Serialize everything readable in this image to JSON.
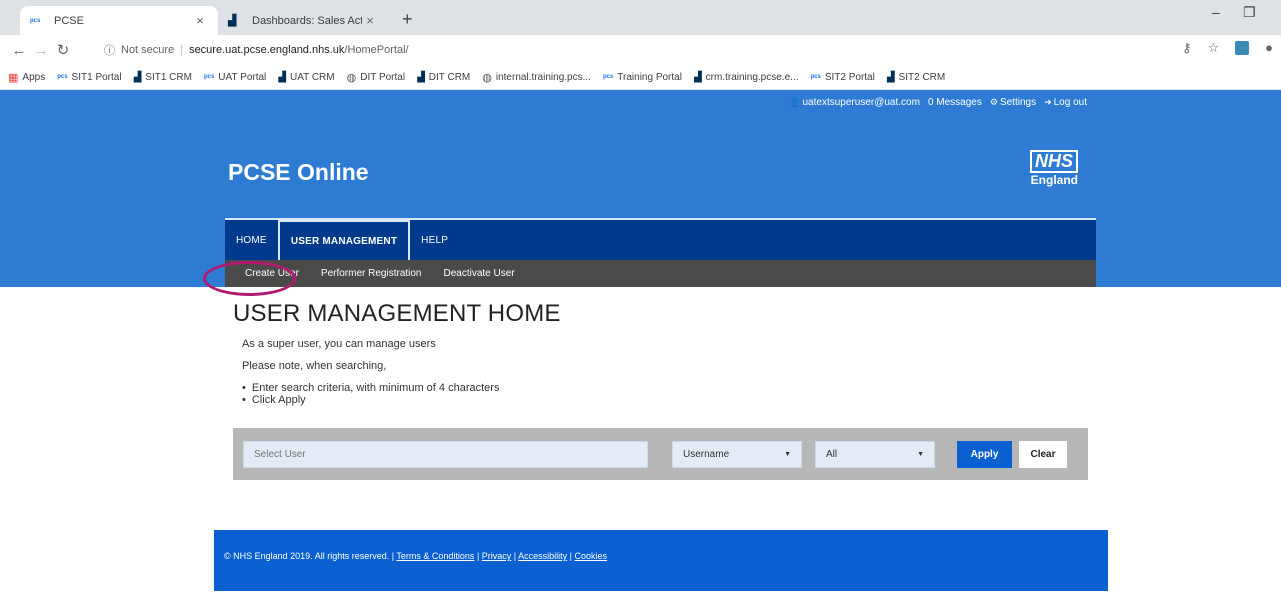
{
  "browser": {
    "tabs": [
      {
        "favicon": "pcs",
        "title": "PCSE",
        "close": "×"
      },
      {
        "favicon": "crm",
        "title": "Dashboards: Sales Activity Social",
        "close": "×"
      }
    ],
    "new_tab": "+",
    "window_controls": {
      "minimize": "–",
      "restore": "❐"
    },
    "address": {
      "security": "Not secure",
      "host": "secure.uat.pcse.england.nhs.uk",
      "path": "/HomePortal/"
    },
    "bookmarks": [
      {
        "icon": "apps",
        "label": "Apps"
      },
      {
        "icon": "pcs",
        "label": "SIT1 Portal"
      },
      {
        "icon": "crm",
        "label": "SIT1 CRM"
      },
      {
        "icon": "pcs",
        "label": "UAT Portal"
      },
      {
        "icon": "crm",
        "label": "UAT CRM"
      },
      {
        "icon": "globe",
        "label": "DIT Portal"
      },
      {
        "icon": "crm",
        "label": "DIT CRM"
      },
      {
        "icon": "globe",
        "label": "internal.training.pcs..."
      },
      {
        "icon": "pcs",
        "label": "Training Portal"
      },
      {
        "icon": "crm",
        "label": "crm.training.pcse.e..."
      },
      {
        "icon": "pcs",
        "label": "SIT2 Portal"
      },
      {
        "icon": "crm",
        "label": "SIT2 CRM"
      }
    ]
  },
  "site": {
    "user_bar": {
      "user": "uatextsuperuser@uat.com",
      "messages": "0 Messages",
      "settings": "Settings",
      "logout": "Log out"
    },
    "title": "PCSE Online",
    "logo": {
      "nhs": "NHS",
      "region": "England"
    },
    "nav": [
      {
        "label": "HOME",
        "active": false
      },
      {
        "label": "USER MANAGEMENT",
        "active": true
      },
      {
        "label": "HELP",
        "active": false
      }
    ],
    "subnav": [
      "Create User",
      "Performer Registration",
      "Deactivate User"
    ],
    "heading": "USER MANAGEMENT HOME",
    "intro_1": "As a super user, you can manage users",
    "intro_2": "Please note, when searching,",
    "bullets": [
      "Enter search criteria, with minimum of 4 characters",
      "Click Apply"
    ],
    "search": {
      "placeholder": "Select User",
      "field_select": "Username",
      "status_select": "All",
      "apply": "Apply",
      "clear": "Clear"
    },
    "footer": {
      "copyright": "© NHS England 2019. All rights reserved. |",
      "links": [
        "Terms & Conditions",
        "Privacy",
        "Accessibility",
        "Cookies"
      ]
    }
  },
  "colors": {
    "header_blue": "#2e7bd3",
    "nav_blue": "#003a8c",
    "subnav_grey": "#4a4a4a",
    "apply_blue": "#0a5fd1",
    "highlight_oval": "#b21a6f"
  }
}
